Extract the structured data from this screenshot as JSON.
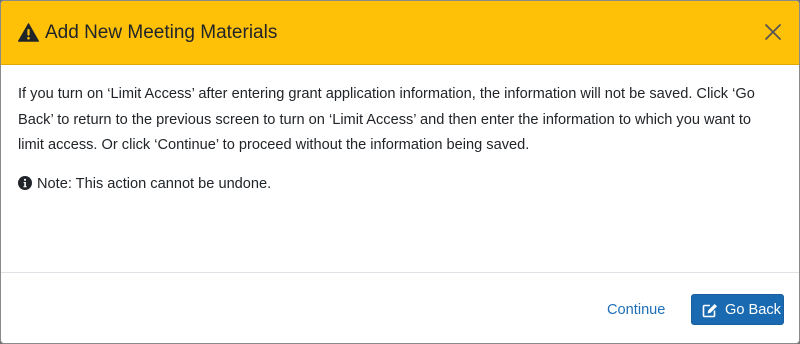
{
  "modal": {
    "title": "Add New Meeting Materials",
    "title_icon": "warning-triangle-icon",
    "close_icon": "close-icon",
    "body_text": "If you turn on ‘Limit Access’ after entering grant application information, the information will not be saved. Click ‘Go Back’ to return to the previous screen to turn on ‘Limit Access’ and then enter the information to which you want to limit access. Or click ‘Continue’ to proceed without the information being saved.",
    "note_icon": "info-circle-icon",
    "note_text": "Note: This action cannot be undone.",
    "continue_label": "Continue",
    "goback_label": "Go Back",
    "goback_icon": "edit-icon"
  },
  "colors": {
    "header_bg": "#ffc107",
    "primary_button": "#1a6ab1",
    "link": "#1d6fb8",
    "text": "#212529"
  }
}
